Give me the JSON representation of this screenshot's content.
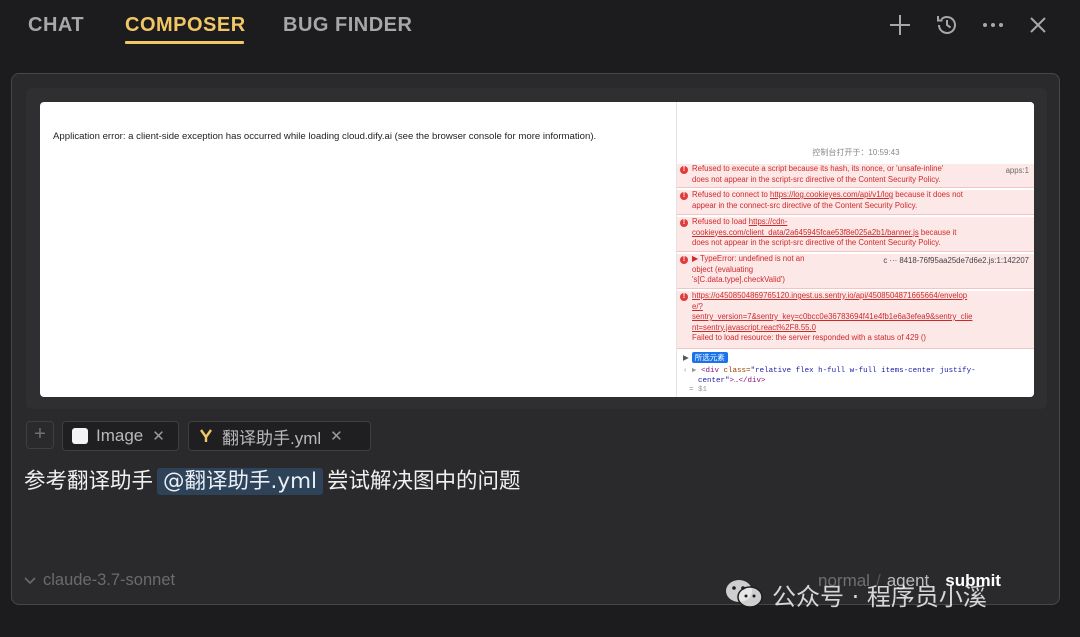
{
  "tabs": [
    {
      "label": "CHAT"
    },
    {
      "label": "COMPOSER"
    },
    {
      "label": "BUG FINDER"
    }
  ],
  "top_icons": [
    "plus-icon",
    "history-icon",
    "more-icon",
    "close-icon"
  ],
  "screenshot": {
    "app_error": "Application error: a client-side exception has occurred while loading cloud.dify.ai (see the browser console for more information).",
    "console_time": "控制台打开于：10:59:43",
    "errors": {
      "e1_line1": "Refused to execute a script because its hash, its nonce, or 'unsafe-inline'",
      "e1_src": "apps:1",
      "e1_line2": "does not appear in the script-src directive of the Content Security Policy.",
      "e2_pre": "Refused to connect to ",
      "e2_link": "https://log.cookieyes.com/api/v1/log",
      "e2_post": " because it does not",
      "e2_line2": "appear in the connect-src directive of the Content Security Policy.",
      "e3_pre": "Refused to load ",
      "e3_link1": "https://cdn-",
      "e3_link2": "cookieyes.com/client_data/2a645945fcae53f8e025a2b1/banner.js",
      "e3_post": " because it",
      "e3_line3": "does not appear in the script-src directive of the Content Security Policy.",
      "e4_line1": "▶ TypeError: undefined is not an",
      "e4_src": "c ··· 8418-76f95aa25de7d6e2.js:1:142207",
      "e4_line2": "object (evaluating",
      "e4_line3": "'s[C.data.type].checkValid')",
      "e5_link1": "https://o4508504869765120.ingest.us.sentry.io/api/4508504871665664/envelop",
      "e5_link2": "e/?",
      "e5_link3": "sentry_version=7&sentry_key=c0bcc0e36783694f41e4fb1e6a3efea9&sentry_clie",
      "e5_link4": "nt=sentry.javascript.react%2F8.55.0",
      "e5_line5": "Failed to load resource: the server responded with a status of 429 ()"
    },
    "selected_label": "所选元素",
    "code_line1_tag_open": "<div",
    "code_line1_attr": " class=",
    "code_line1_val": "\"relative flex h-full w-full items-center justify-",
    "code_line2_val": "center\"",
    "code_line2_rest": ">…</div>",
    "code_line3": "= $1"
  },
  "attachments": [
    {
      "label": "Image",
      "icon": "image-icon"
    },
    {
      "label": "翻译助手.yml",
      "icon": "yaml-file-icon"
    }
  ],
  "prompt": {
    "before": "参考翻译助手",
    "mention": "@翻译助手.yml",
    "after": "尝试解决图中的问题"
  },
  "footer": {
    "model": "claude-3.7-sonnet",
    "mode_normal": "normal",
    "mode_sep": "/",
    "mode_agent": "agent",
    "submit": "submit"
  },
  "watermark": "公众号 · 程序员小溪",
  "colors": {
    "accent": "#f1c765",
    "background": "#1c1b1d",
    "panel": "#2a292c",
    "mention_bg": "#2e4258",
    "error_text": "#cf2a2a"
  }
}
